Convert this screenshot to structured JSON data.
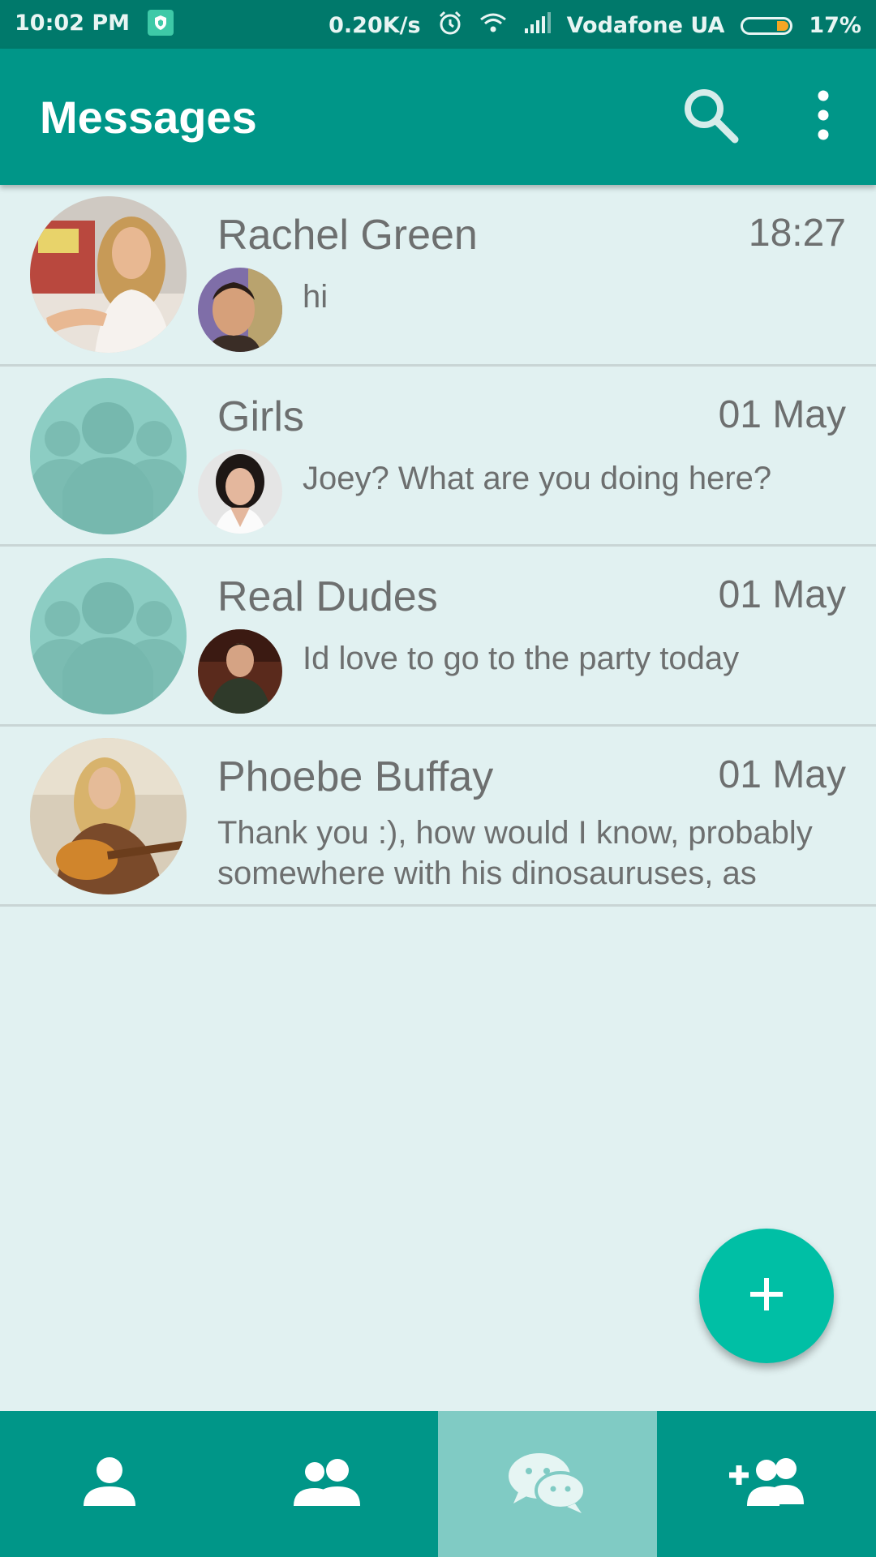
{
  "status_bar": {
    "time": "10:02 PM",
    "speed": "0.20K/s",
    "carrier": "Vodafone UA",
    "battery": "17%",
    "icons": [
      "shield-icon",
      "alarm-icon",
      "wifi-icon",
      "signal-icon",
      "battery-icon"
    ]
  },
  "app_bar": {
    "title": "Messages",
    "icons": [
      "search-icon",
      "more-vert-icon"
    ]
  },
  "conversations": [
    {
      "name": "Rachel Green",
      "time": "18:27",
      "preview": "hi"
    },
    {
      "name": "Girls",
      "time": "01 May",
      "preview": "Joey? What are you doing here?"
    },
    {
      "name": "Real Dudes",
      "time": "01 May",
      "preview": "Id love to go to the party today"
    },
    {
      "name": "Phoebe Buffay",
      "time": "01 May",
      "preview": "Thank you :), how would I know, probably somewhere with his dinosauruses, as"
    }
  ],
  "fab": {
    "icon": "plus-icon"
  },
  "bottom_nav": {
    "tabs": [
      {
        "icon": "person-icon",
        "active": false
      },
      {
        "icon": "group-icon",
        "active": false
      },
      {
        "icon": "chat-icon",
        "active": true
      },
      {
        "icon": "add-friend-icon",
        "active": false
      }
    ]
  },
  "colors": {
    "status_bar": "#00796b",
    "primary": "#009688",
    "accent": "#00bfa5",
    "background": "#e1f1f1",
    "active_tab": "#80cbc4",
    "text": "#6d6f6f"
  }
}
